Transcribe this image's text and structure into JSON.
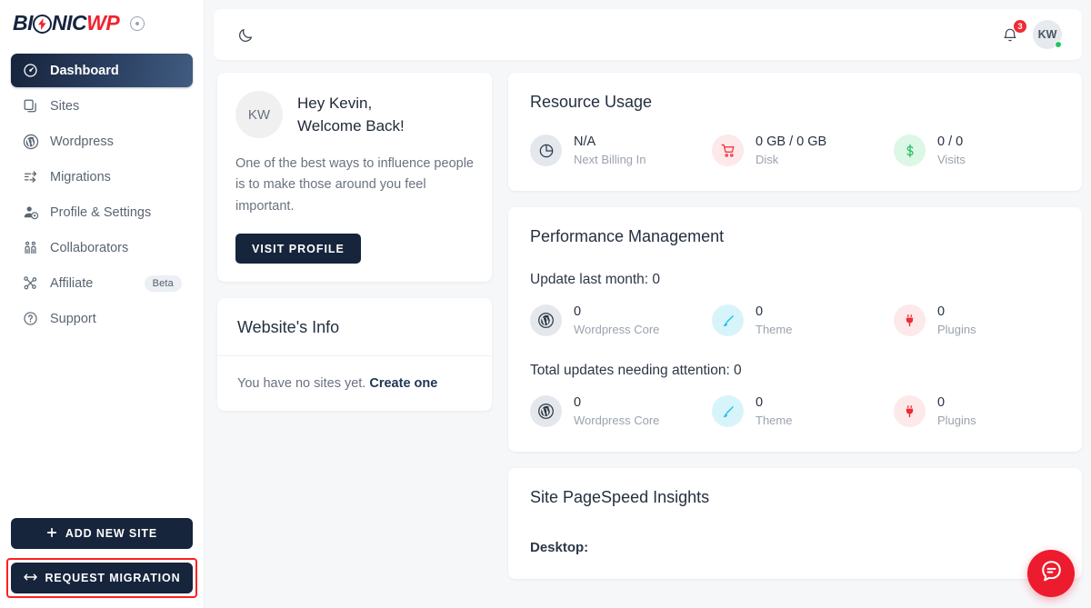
{
  "brand": {
    "logo_part1": "BI",
    "logo_bolt_icon": "lightning-bolt-icon",
    "logo_part2": "NIC",
    "logo_part3": "WP",
    "dark_color": "#16243c",
    "red_color": "#f2222e"
  },
  "sidebar": {
    "items": [
      {
        "label": "Dashboard",
        "icon": "gauge-icon",
        "active": true,
        "badge": ""
      },
      {
        "label": "Sites",
        "icon": "copy-icon",
        "active": false,
        "badge": ""
      },
      {
        "label": "Wordpress",
        "icon": "wordpress-icon",
        "active": false,
        "badge": ""
      },
      {
        "label": "Migrations",
        "icon": "migration-icon",
        "active": false,
        "badge": ""
      },
      {
        "label": "Profile & Settings",
        "icon": "user-gear-icon",
        "active": false,
        "badge": ""
      },
      {
        "label": "Collaborators",
        "icon": "people-icon",
        "active": false,
        "badge": ""
      },
      {
        "label": "Affiliate",
        "icon": "share-nodes-icon",
        "active": false,
        "badge": "Beta"
      },
      {
        "label": "Support",
        "icon": "question-circle-icon",
        "active": false,
        "badge": ""
      }
    ],
    "add_site_label": "ADD NEW SITE",
    "add_site_icon": "plus-icon",
    "request_migration_label": "REQUEST MIGRATION",
    "request_migration_icon": "arrows-left-right-icon",
    "request_migration_highlighted": true,
    "highlight_color": "#ff1f1f"
  },
  "topbar": {
    "theme_toggle_icon": "moon-icon",
    "notifications_icon": "bell-icon",
    "notifications_count": "3",
    "avatar_initials": "KW",
    "status_color": "#22c55e"
  },
  "welcome": {
    "avatar_initials": "KW",
    "greeting_line1": "Hey Kevin,",
    "greeting_line2": "Welcome Back!",
    "quote": "One of the best ways to influence people is to make those around you feel important.",
    "button_label": "VISIT PROFILE"
  },
  "website_info": {
    "title": "Website's Info",
    "empty_text": "You have no sites yet.",
    "empty_link": "Create one"
  },
  "resource_usage": {
    "title": "Resource Usage",
    "stats": [
      {
        "value": "N/A",
        "label": "Next Billing In",
        "icon": "pie-chart-icon",
        "bg": "#e4e7ec",
        "fg": "#2b3a52"
      },
      {
        "value": "0 GB / 0 GB",
        "label": "Disk",
        "icon": "shopping-cart-icon",
        "bg": "#fde8ea",
        "fg": "#ef2b33"
      },
      {
        "value": "0 / 0",
        "label": "Visits",
        "icon": "dollar-icon",
        "bg": "#dcf7e6",
        "fg": "#23bf61"
      }
    ]
  },
  "performance": {
    "title": "Performance Management",
    "sections": [
      {
        "heading": "Update last month: 0",
        "stats": [
          {
            "value": "0",
            "label": "Wordpress Core",
            "icon": "wordpress-icon",
            "bg": "#e4e7ec",
            "fg": "#2b3440"
          },
          {
            "value": "0",
            "label": "Theme",
            "icon": "paint-brush-icon",
            "bg": "#d8f4fb",
            "fg": "#29c0ee"
          },
          {
            "value": "0",
            "label": "Plugins",
            "icon": "plug-icon",
            "bg": "#fde8ea",
            "fg": "#ef2b33"
          }
        ]
      },
      {
        "heading": "Total updates needing attention: 0",
        "stats": [
          {
            "value": "0",
            "label": "Wordpress Core",
            "icon": "wordpress-icon",
            "bg": "#e4e7ec",
            "fg": "#2b3440"
          },
          {
            "value": "0",
            "label": "Theme",
            "icon": "paint-brush-icon",
            "bg": "#d8f4fb",
            "fg": "#29c0ee"
          },
          {
            "value": "0",
            "label": "Plugins",
            "icon": "plug-icon",
            "bg": "#fde8ea",
            "fg": "#ef2b33"
          }
        ]
      }
    ]
  },
  "pagespeed": {
    "title": "Site PageSpeed Insights",
    "desktop_label": "Desktop:"
  },
  "chat_widget": {
    "icon": "chat-bubble-icon",
    "color": "#ed1b2e"
  }
}
